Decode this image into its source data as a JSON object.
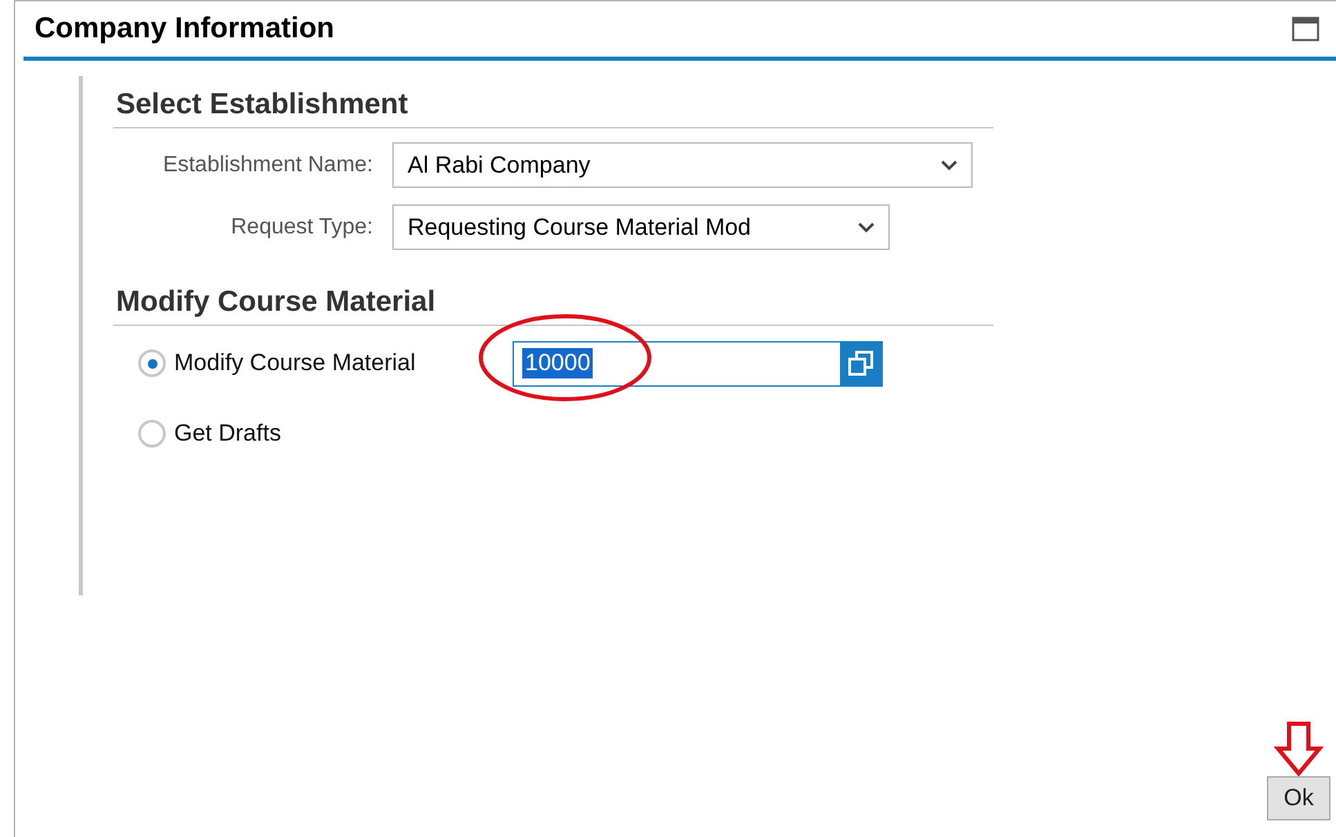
{
  "window": {
    "title": "Company Information"
  },
  "sections": [
    {
      "title": "Select Establishment",
      "fields": [
        {
          "kind": "dropdown",
          "label": "Establishment Name:",
          "value": "Al Rabi Company"
        },
        {
          "kind": "dropdown",
          "label": "Request Type:",
          "value": "Requesting Course Material Mod"
        }
      ]
    },
    {
      "title": "Modify Course Material",
      "options": [
        {
          "label": "Modify Course Material",
          "selected": true,
          "input": {
            "value": "10000",
            "highlighted": true
          }
        },
        {
          "label": "Get Drafts",
          "selected": false
        }
      ]
    }
  ],
  "buttons": [
    {
      "label": "Ok"
    }
  ]
}
